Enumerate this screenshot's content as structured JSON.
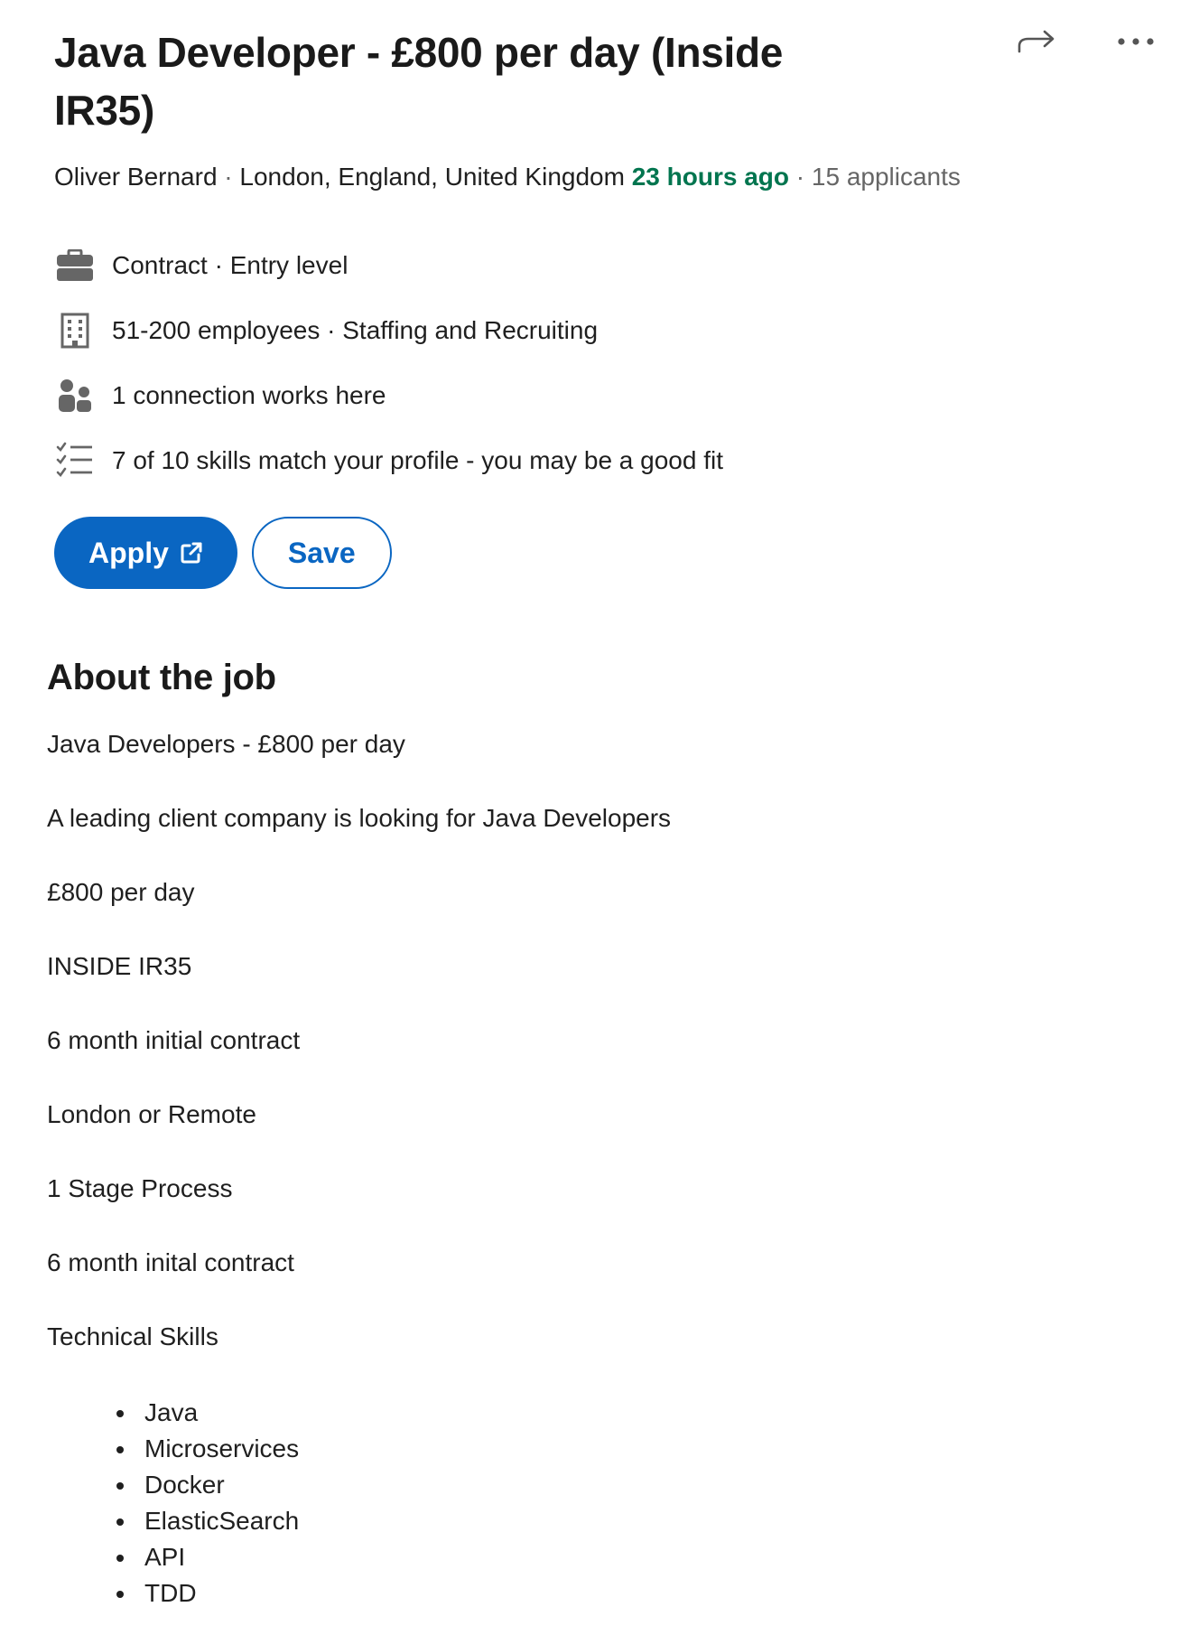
{
  "job": {
    "title": "Java Developer - £800 per day (Inside IR35)",
    "poster": "Oliver Bernard",
    "separator": "·",
    "location": "London, England, United Kingdom",
    "posted": "23 hours ago",
    "applicants": "15 applicants"
  },
  "insights": [
    {
      "icon": "briefcase-icon",
      "text": "Contract · Entry level"
    },
    {
      "icon": "building-icon",
      "text": "51-200 employees · Staffing and Recruiting"
    },
    {
      "icon": "people-icon",
      "text": "1 connection works here"
    },
    {
      "icon": "checklist-icon",
      "text": "7 of 10 skills match your profile - you may be a good fit"
    }
  ],
  "buttons": {
    "apply": "Apply",
    "save": "Save"
  },
  "about": {
    "heading": "About the job",
    "paragraphs": [
      "Java Developers - £800 per day",
      "A leading client company is looking for Java Developers",
      "£800 per day",
      "INSIDE IR35",
      "6 month initial contract",
      "London or Remote",
      "1 Stage Process",
      "6 month inital contract",
      "Technical Skills"
    ],
    "skills": [
      "Java",
      "Microservices",
      "Docker",
      "ElasticSearch",
      "API",
      "TDD"
    ]
  },
  "colors": {
    "accent": "#0a66c2",
    "posted_green": "#01754f",
    "muted": "#666666"
  }
}
